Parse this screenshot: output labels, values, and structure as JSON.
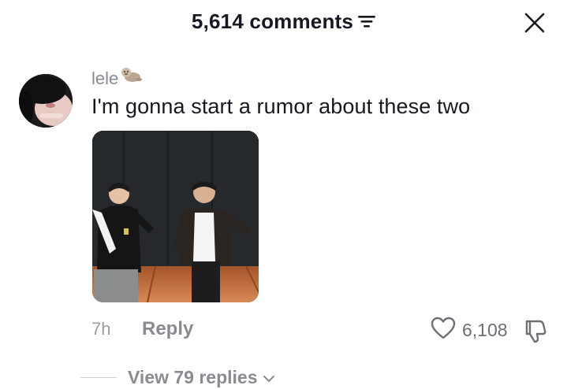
{
  "header": {
    "comment_count_label": "5,614 comments",
    "filter_icon": "filter-icon",
    "close_icon": "close-icon"
  },
  "comment": {
    "username": "lele",
    "username_emoji": "otter-emoji",
    "text": "I'm gonna start a rumor about these two",
    "time": "7h",
    "reply_label": "Reply",
    "like_count": "6,108",
    "view_replies_label": "View 79 replies"
  },
  "colors": {
    "text_primary": "#161823",
    "text_secondary": "#8a8b91",
    "background": "#ffffff"
  }
}
